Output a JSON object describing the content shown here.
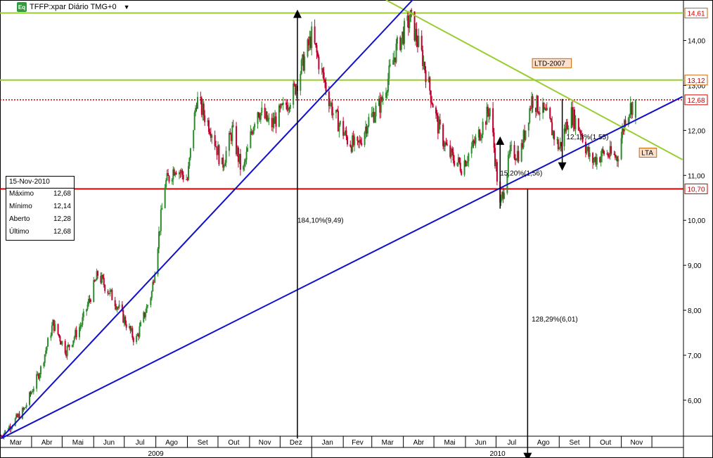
{
  "header": {
    "logo_text": "Eq",
    "title": "TFFP:xpar Diário TMG+0"
  },
  "info_box": {
    "date": "15-Nov-2010",
    "rows": [
      {
        "label": "Máximo",
        "value": "12,68"
      },
      {
        "label": "Mínimo",
        "value": "12,14"
      },
      {
        "label": "Aberto",
        "value": "12,28"
      },
      {
        "label": "Último",
        "value": "12,68"
      }
    ]
  },
  "colors": {
    "up": "#2d8a2d",
    "down": "#c0002c",
    "trend_blue": "#1010cc",
    "trend_green": "#9acd32",
    "resistance_red": "#cc0000"
  },
  "chart_data": {
    "type": "candlestick",
    "x_axis": {
      "months": [
        "Mar",
        "Abr",
        "Mai",
        "Jun",
        "Jul",
        "Ago",
        "Set",
        "Out",
        "Nov",
        "Dez",
        "Jan",
        "Fev",
        "Mar",
        "Abr",
        "Mai",
        "Jun",
        "Jul",
        "Ago",
        "Set",
        "Out",
        "Nov"
      ],
      "years": [
        "2009",
        "2010"
      ]
    },
    "y_axis": {
      "ticks": [
        "6,00",
        "7,00",
        "8,00",
        "9,00",
        "10,00",
        "11,00",
        "12,00",
        "13,00",
        "14,00"
      ],
      "range": [
        5.2,
        14.9
      ]
    },
    "price_path": [
      [
        "2009-03-02",
        5.2
      ],
      [
        "2009-03-25",
        5.8
      ],
      [
        "2009-04-10",
        6.7
      ],
      [
        "2009-04-22",
        7.7
      ],
      [
        "2009-05-05",
        7.1
      ],
      [
        "2009-05-20",
        7.7
      ],
      [
        "2009-06-05",
        8.8
      ],
      [
        "2009-06-22",
        8.2
      ],
      [
        "2009-07-12",
        7.3
      ],
      [
        "2009-07-28",
        8.4
      ],
      [
        "2009-08-10",
        10.8
      ],
      [
        "2009-08-20",
        11.2
      ],
      [
        "2009-09-01",
        10.9
      ],
      [
        "2009-09-10",
        12.7
      ],
      [
        "2009-09-25",
        12.0
      ],
      [
        "2009-10-05",
        11.2
      ],
      [
        "2009-10-15",
        12.0
      ],
      [
        "2009-10-25",
        11.0
      ],
      [
        "2009-11-08",
        12.5
      ],
      [
        "2009-11-22",
        12.1
      ],
      [
        "2009-12-05",
        12.5
      ],
      [
        "2009-12-15",
        12.9
      ],
      [
        "2010-01-01",
        14.1
      ],
      [
        "2010-01-12",
        13.2
      ],
      [
        "2010-01-22",
        12.4
      ],
      [
        "2010-02-05",
        11.8
      ],
      [
        "2010-02-15",
        11.6
      ],
      [
        "2010-02-25",
        12.2
      ],
      [
        "2010-03-10",
        12.6
      ],
      [
        "2010-03-25",
        13.8
      ],
      [
        "2010-04-08",
        14.5
      ],
      [
        "2010-04-20",
        13.6
      ],
      [
        "2010-05-05",
        12.1
      ],
      [
        "2010-05-15",
        11.5
      ],
      [
        "2010-05-28",
        11.2
      ],
      [
        "2010-06-12",
        11.8
      ],
      [
        "2010-06-25",
        12.5
      ],
      [
        "2010-07-05",
        10.3
      ],
      [
        "2010-07-15",
        11.5
      ],
      [
        "2010-07-25",
        11.5
      ],
      [
        "2010-08-05",
        12.7
      ],
      [
        "2010-08-20",
        12.3
      ],
      [
        "2010-09-01",
        11.6
      ],
      [
        "2010-09-12",
        12.4
      ],
      [
        "2010-09-22",
        12.0
      ],
      [
        "2010-10-02",
        11.3
      ],
      [
        "2010-10-15",
        11.5
      ],
      [
        "2010-10-28",
        11.4
      ],
      [
        "2010-11-05",
        12.3
      ],
      [
        "2010-11-12",
        12.6
      ],
      [
        "2010-11-15",
        12.68
      ]
    ],
    "last_candle": {
      "date": "15-Nov-2010",
      "high": 12.68,
      "low": 12.14,
      "open": 12.28,
      "close": 12.68
    },
    "levels": [
      {
        "value": 14.61,
        "label": "14,61",
        "color": "#9acd32"
      },
      {
        "value": 13.12,
        "label": "13,12",
        "color": "#9acd32"
      },
      {
        "value": 12.68,
        "label": "12,68",
        "color": "#cc0000",
        "style": "dotted"
      },
      {
        "value": 10.7,
        "label": "10,70",
        "color": "#cc0000"
      }
    ],
    "trendlines": [
      {
        "label": "LTD-2007",
        "color": "#9acd32",
        "from": [
          "2010-03-15",
          14.9
        ],
        "to": [
          "2010-12-31",
          11.35
        ]
      },
      {
        "label": "LTA",
        "color": "#1010cc",
        "from": [
          "2009-03-02",
          5.15
        ],
        "to": [
          "2010-12-31",
          12.75
        ]
      },
      {
        "label": "",
        "color": "#1010cc",
        "from": [
          "2009-03-02",
          5.15
        ],
        "to": [
          "2010-04-10",
          14.9
        ]
      }
    ],
    "measurements": [
      {
        "label": "184,10%(9,49)",
        "from": [
          "2009-12-18",
          5.15
        ],
        "to": [
          "2009-12-18",
          14.64
        ]
      },
      {
        "label": "128,29%(6,01)",
        "from": [
          "2010-08-01",
          10.7
        ],
        "to": [
          "2010-08-01",
          4.69
        ]
      },
      {
        "label": "15,20%(1,56)",
        "from": [
          "2010-07-05",
          10.26
        ],
        "to": [
          "2010-07-05",
          11.82
        ]
      },
      {
        "label": "12,13%(1,55)",
        "from": [
          "2010-09-04",
          12.7
        ],
        "to": [
          "2010-09-04",
          11.15
        ]
      }
    ]
  }
}
